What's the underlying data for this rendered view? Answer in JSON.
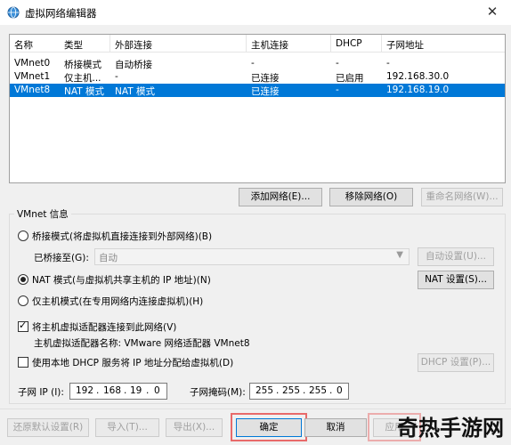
{
  "window": {
    "title": "虚拟网络编辑器",
    "close_glyph": "✕"
  },
  "table": {
    "headers": [
      "名称",
      "类型",
      "外部连接",
      "主机连接",
      "DHCP",
      "子网地址"
    ],
    "rows": [
      [
        "VMnet0",
        "桥接模式",
        "自动桥接",
        "-",
        "-",
        "-"
      ],
      [
        "VMnet1",
        "仅主机...",
        "-",
        "已连接",
        "已启用",
        "192.168.30.0"
      ],
      [
        "VMnet8",
        "NAT 模式",
        "NAT 模式",
        "已连接",
        "-",
        "192.168.19.0"
      ]
    ],
    "selected_row": 2
  },
  "list_buttons": {
    "add": "添加网络(E)...",
    "remove": "移除网络(O)",
    "rename": "重命名网络(W)..."
  },
  "vmnet_info": {
    "group_title": "VMnet 信息",
    "bridged_radio": "桥接模式(将虚拟机直接连接到外部网络)(B)",
    "bridged_to_label": "已桥接至(G):",
    "bridged_to_value": "自动",
    "auto_settings": "自动设置(U)...",
    "nat_radio": "NAT 模式(与虚拟机共享主机的 IP 地址)(N)",
    "nat_settings": "NAT 设置(S)...",
    "hostonly_radio": "仅主机模式(在专用网络内连接虚拟机)(H)",
    "connect_adapter_check": "将主机虚拟适配器连接到此网络(V)",
    "adapter_name_label": "主机虚拟适配器名称: VMware 网络适配器 VMnet8",
    "dhcp_check": "使用本地 DHCP 服务将 IP 地址分配给虚拟机(D)",
    "dhcp_settings": "DHCP 设置(P)...",
    "subnet_ip_label": "子网 IP (I):",
    "subnet_ip": [
      "192",
      "168",
      "19",
      "0"
    ],
    "subnet_mask_label": "子网掩码(M):",
    "subnet_mask": [
      "255",
      "255",
      "255",
      "0"
    ],
    "ip_dot": "."
  },
  "footer": {
    "restore": "还原默认设置(R)",
    "import": "导入(T)...",
    "export": "导出(X)...",
    "ok": "确定",
    "cancel": "取消",
    "apply": "应用",
    "watermark": "奇热手游网"
  }
}
